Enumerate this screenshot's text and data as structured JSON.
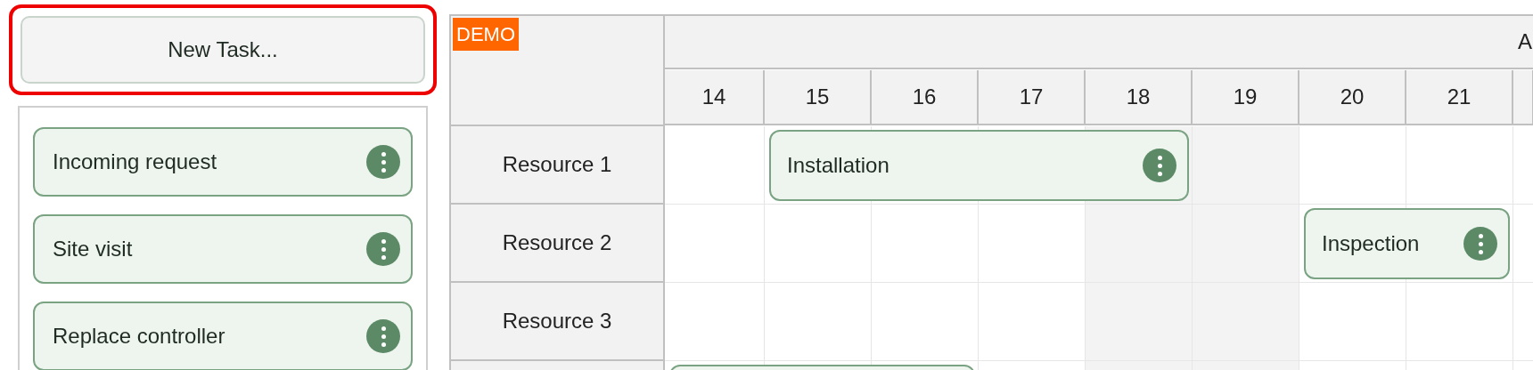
{
  "new_task_button": {
    "label": "New Task...",
    "highlighted": true
  },
  "task_list": [
    {
      "label": "Incoming request"
    },
    {
      "label": "Site visit"
    },
    {
      "label": "Replace controller"
    }
  ],
  "scheduler": {
    "badge": "DEMO",
    "month_header": "A",
    "days": [
      {
        "label": "14",
        "weekend": false
      },
      {
        "label": "15",
        "weekend": false
      },
      {
        "label": "16",
        "weekend": false
      },
      {
        "label": "17",
        "weekend": false
      },
      {
        "label": "18",
        "weekend": true
      },
      {
        "label": "19",
        "weekend": true
      },
      {
        "label": "20",
        "weekend": false
      },
      {
        "label": "21",
        "weekend": false
      }
    ],
    "resources": [
      {
        "name": "Resource 1",
        "events": [
          {
            "kind": "task",
            "label": "Installation"
          }
        ]
      },
      {
        "name": "Resource 2",
        "events": [
          {
            "kind": "task",
            "label": "Inspection"
          }
        ]
      },
      {
        "name": "Resource 3"
      },
      {
        "events": [
          {
            "kind": "task"
          }
        ]
      }
    ]
  }
}
